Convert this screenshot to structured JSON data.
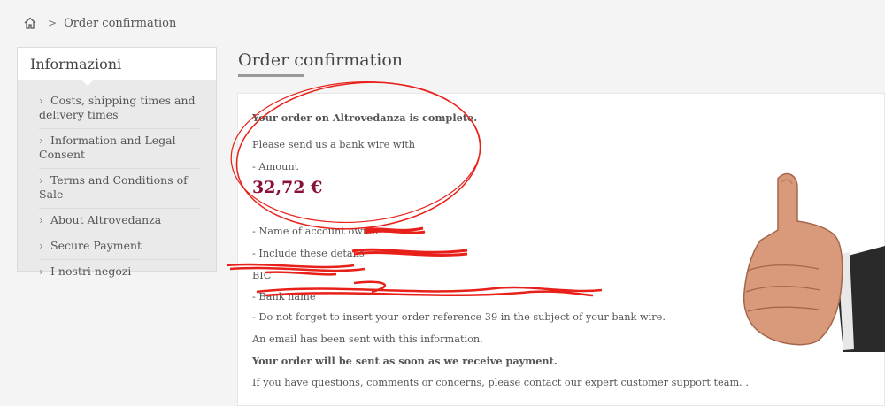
{
  "breadcrumb": {
    "home_icon": "home-icon",
    "separator": ">",
    "current": "Order confirmation"
  },
  "sidebar": {
    "title": "Informazioni",
    "items": [
      {
        "label": "Costs, shipping times and delivery times"
      },
      {
        "label": "Information and Legal Consent"
      },
      {
        "label": "Terms and Conditions of Sale"
      },
      {
        "label": "About Altrovedanza"
      },
      {
        "label": "Secure Payment"
      },
      {
        "label": "I nostri negozi"
      }
    ]
  },
  "main": {
    "title": "Order confirmation",
    "lines": {
      "complete": "Your order on Altrovedanza is complete.",
      "send": "Please send us a bank wire with",
      "amount_label": "- Amount",
      "amount_value": "32,72 €",
      "owner": "- Name of account owner",
      "include": "- Include these details",
      "bic": "BIC",
      "bank": "- Bank name",
      "reference": "- Do not forget to insert your order reference 39 in the subject of your bank wire.",
      "email": "An email has been sent with this information.",
      "shipment": "Your order will be sent as soon as we receive payment.",
      "questions": "If you have questions, comments or concerns, please contact our expert customer support team. ."
    }
  },
  "colors": {
    "amount": "#8a0f36",
    "annotation": "#e8201a"
  }
}
